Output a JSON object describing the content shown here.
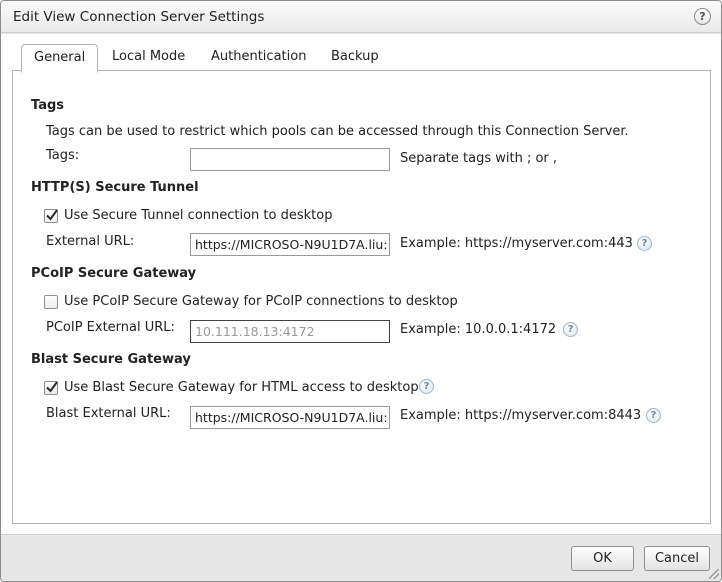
{
  "dialog": {
    "title": "Edit View Connection Server Settings",
    "help_label": "?"
  },
  "tabs": [
    {
      "label": "General",
      "active": true
    },
    {
      "label": "Local Mode",
      "active": false
    },
    {
      "label": "Authentication",
      "active": false
    },
    {
      "label": "Backup",
      "active": false
    }
  ],
  "tags": {
    "heading": "Tags",
    "description": "Tags can be used to restrict which pools can be accessed through this Connection Server.",
    "field_label": "Tags:",
    "value": "",
    "hint": "Separate tags with ; or ,"
  },
  "secure_tunnel": {
    "heading": "HTTP(S) Secure Tunnel",
    "checkbox_label": "Use Secure Tunnel connection to desktop",
    "checked": true,
    "field_label": "External URL:",
    "value": "https://MICROSO-N9U1D7A.liu:",
    "example": "Example: https://myserver.com:443"
  },
  "pcoip": {
    "heading": "PCoIP Secure Gateway",
    "checkbox_label": "Use PCoIP Secure Gateway for PCoIP connections to desktop",
    "checked": false,
    "field_label": "PCoIP External URL:",
    "value": "10.111.18.13:4172",
    "example": "Example: 10.0.0.1:4172"
  },
  "blast": {
    "heading": "Blast Secure Gateway",
    "checkbox_label": "Use Blast Secure Gateway for HTML access to desktop",
    "checked": true,
    "field_label": "Blast External URL:",
    "value": "https://MICROSO-N9U1D7A.liu:",
    "example": "Example: https://myserver.com:8443"
  },
  "footer": {
    "ok_label": "OK",
    "cancel_label": "Cancel"
  },
  "colors": {
    "dialog_background": "#e7e7e7",
    "panel_background": "#ffffff",
    "help_icon": "#6d8aa0"
  }
}
